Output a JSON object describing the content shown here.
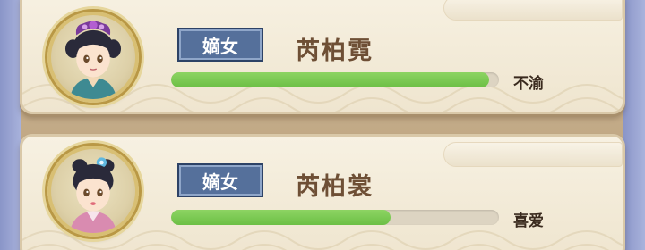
{
  "consorts": [
    {
      "rank": "嫡女",
      "name": "芮柏霓",
      "mood": "不渝",
      "favor_fraction": 0.97,
      "portrait_icon": "consort-portrait-purple-headdress",
      "robe_color": "#3e8a92"
    },
    {
      "rank": "嫡女",
      "name": "芮柏裳",
      "mood": "喜爱",
      "favor_fraction": 0.67,
      "portrait_icon": "consort-portrait-blue-flower",
      "robe_color": "#d98bb0"
    }
  ],
  "colors": {
    "favor_bar": "#6cbf45",
    "rank_badge": "#55709b",
    "name_text": "#6e4f35"
  }
}
